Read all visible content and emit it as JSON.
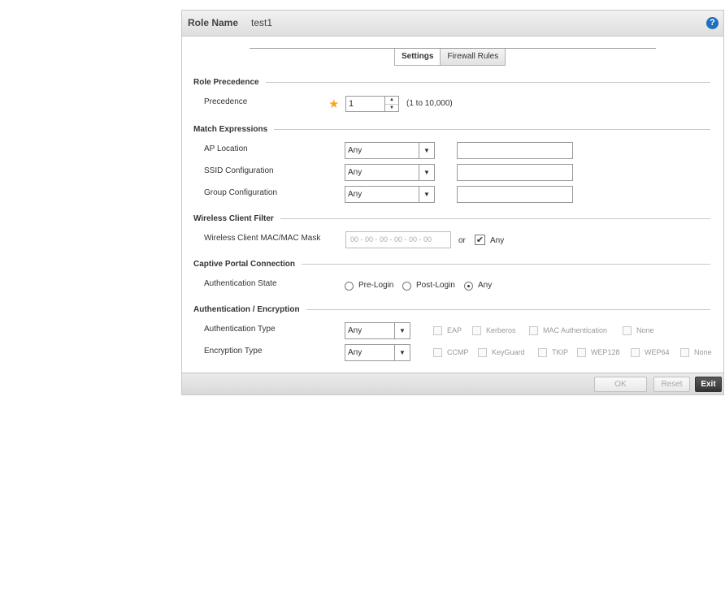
{
  "header": {
    "label": "Role Name",
    "value": "test1",
    "help_icon": "?"
  },
  "tabs": [
    {
      "label": "Settings"
    },
    {
      "label": "Firewall Rules"
    }
  ],
  "role_precedence": {
    "title": "Role Precedence",
    "precedence_label": "Precedence",
    "required_mark": "★",
    "precedence_value": "1",
    "precedence_hint": "(1 to 10,000)"
  },
  "match_expressions": {
    "title": "Match Expressions",
    "rows": [
      {
        "label": "AP Location",
        "select": "Any",
        "text": ""
      },
      {
        "label": "SSID Configuration",
        "select": "Any",
        "text": ""
      },
      {
        "label": "Group Configuration",
        "select": "Any",
        "text": ""
      }
    ]
  },
  "wireless_client_filter": {
    "title": "Wireless Client Filter",
    "mac_label": "Wireless Client MAC/MAC Mask",
    "mac_placeholder": "00 - 00 - 00 - 00 - 00 - 00",
    "or_label": "or",
    "any_label": "Any",
    "any_checked": true
  },
  "captive_portal": {
    "title": "Captive Portal Connection",
    "auth_state_label": "Authentication State",
    "options": [
      "Pre-Login",
      "Post-Login",
      "Any"
    ],
    "selected": "Any"
  },
  "auth_encryption": {
    "title": "Authentication / Encryption",
    "auth_type_label": "Authentication Type",
    "auth_type_select": "Any",
    "auth_options": [
      "EAP",
      "Kerberos",
      "MAC Authentication",
      "None"
    ],
    "enc_type_label": "Encryption Type",
    "enc_type_select": "Any",
    "enc_options": [
      "CCMP",
      "KeyGuard",
      "TKIP",
      "WEP128",
      "WEP64",
      "None"
    ]
  },
  "footer": {
    "ok_label": "OK",
    "reset_label": "Reset",
    "exit_label": "Exit"
  }
}
